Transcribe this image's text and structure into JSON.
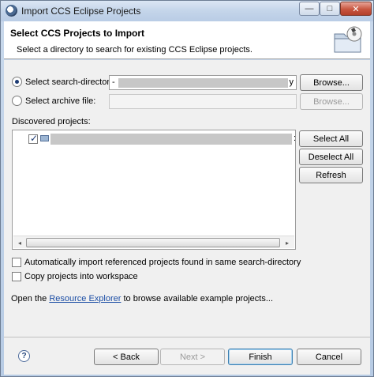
{
  "window": {
    "title": "Import CCS Eclipse Projects",
    "controls": {
      "minimize": "—",
      "maximize": "□",
      "close": "✕"
    }
  },
  "header": {
    "title": "Select CCS Projects to Import",
    "description": "Select a directory to search for existing CCS Eclipse projects.",
    "image_icon": "folder-with-disc-icon"
  },
  "source": {
    "search_directory": {
      "label": "Select search-directory:",
      "selected": true,
      "value_prefix": "-",
      "value_suffix": "y",
      "browse_label": "Browse..."
    },
    "archive_file": {
      "label": "Select archive file:",
      "selected": false,
      "value": "",
      "browse_label": "Browse..."
    }
  },
  "projects": {
    "label": "Discovered projects:",
    "items": [
      {
        "checked": true,
        "name_redacted": true,
        "suffix": ":"
      }
    ],
    "select_all": "Select All",
    "deselect_all": "Deselect All",
    "refresh": "Refresh",
    "scroll_left": "◂",
    "scroll_right": "▸"
  },
  "options": {
    "auto_import": {
      "label": "Automatically import referenced projects found in same search-directory",
      "checked": false
    },
    "copy_into_workspace": {
      "label": "Copy projects into workspace",
      "checked": false
    }
  },
  "resource_hint": {
    "prefix": "Open the ",
    "link": "Resource Explorer",
    "suffix": " to browse available example projects..."
  },
  "footer": {
    "help": "?",
    "back": "< Back",
    "next": "Next >",
    "finish": "Finish",
    "cancel": "Cancel"
  }
}
